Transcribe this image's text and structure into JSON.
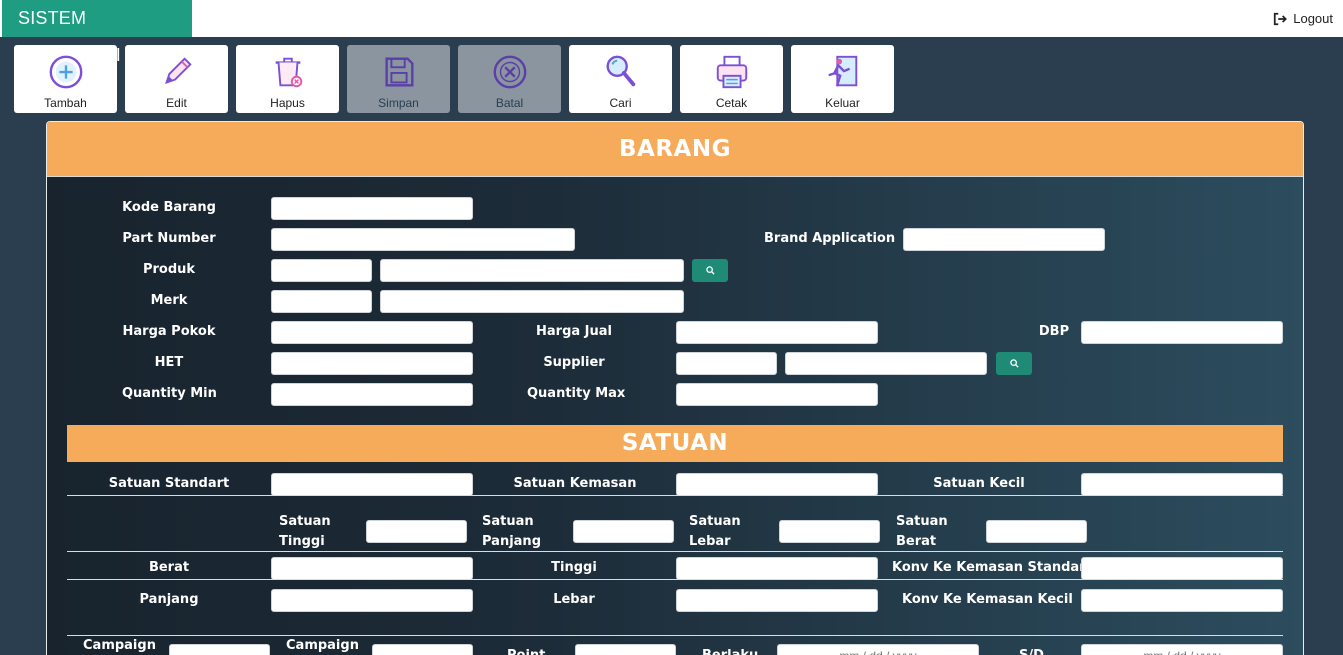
{
  "app": {
    "title": "SISTEM DISTRIBUSI",
    "logout_label": "Logout"
  },
  "toolbar": {
    "buttons": [
      {
        "label": "Tambah",
        "icon": "plus-circle-icon",
        "enabled": true
      },
      {
        "label": "Edit",
        "icon": "pencil-icon",
        "enabled": true
      },
      {
        "label": "Hapus",
        "icon": "trash-icon",
        "enabled": true
      },
      {
        "label": "Simpan",
        "icon": "floppy-disk-icon",
        "enabled": false
      },
      {
        "label": "Batal",
        "icon": "cancel-circle-icon",
        "enabled": false
      },
      {
        "label": "Cari",
        "icon": "magnifier-icon",
        "enabled": true
      },
      {
        "label": "Cetak",
        "icon": "printer-icon",
        "enabled": true
      },
      {
        "label": "Keluar",
        "icon": "exit-running-icon",
        "enabled": true
      }
    ]
  },
  "barang": {
    "title": "BARANG",
    "kode_barang": "Kode Barang",
    "part_number": "Part Number",
    "brand_application": "Brand Application",
    "produk": "Produk",
    "merk": "Merk",
    "harga_pokok": "Harga Pokok",
    "harga_jual": "Harga Jual",
    "dbp": "DBP",
    "het": "HET",
    "supplier": "Supplier",
    "quantity_min": "Quantity Min",
    "quantity_max": "Quantity Max"
  },
  "satuan": {
    "title": "SATUAN",
    "satuan_standart": "Satuan Standart",
    "satuan_kemasan": "Satuan Kemasan",
    "satuan_kecil": "Satuan Kecil",
    "satuan_tinggi": [
      "Satuan",
      "Tinggi"
    ],
    "satuan_panjang": [
      "Satuan",
      "Panjang"
    ],
    "satuan_lebar": [
      "Satuan",
      "Lebar"
    ],
    "satuan_berat": [
      "Satuan",
      "Berat"
    ],
    "berat": "Berat",
    "tinggi": "Tinggi",
    "konv_standart": "Konv Ke Kemasan Standart",
    "panjang": "Panjang",
    "lebar": "Lebar",
    "konv_kecil": "Konv Ke Kemasan Kecil"
  },
  "campaign": {
    "campaign1": "Campaign",
    "campaign2": "Campaign",
    "point": "Point",
    "berlaku": "Berlaku",
    "sd": "S/D",
    "date_placeholder": "mm / dd / yyyy"
  },
  "colors": {
    "brand": "#1f9d83",
    "header": "#f6ab5a",
    "search_button": "#1f8a75"
  }
}
